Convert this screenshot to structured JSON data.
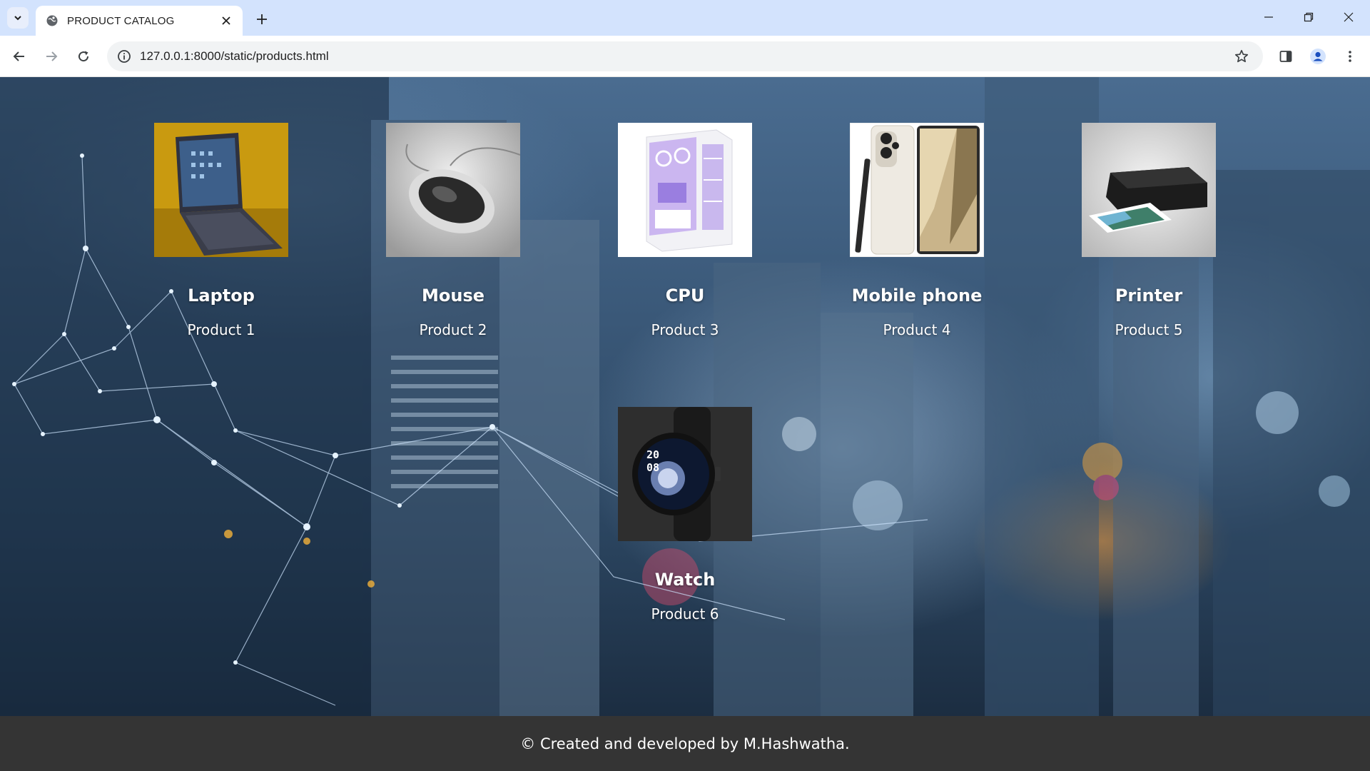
{
  "browser": {
    "tab_title": "PRODUCT CATALOG",
    "url": "127.0.0.1:8000/static/products.html",
    "icons": {
      "tab_search": "chevron-down-icon",
      "close_tab": "close-icon",
      "new_tab": "plus-icon",
      "back": "arrow-left-icon",
      "forward": "arrow-right-icon",
      "reload": "reload-icon",
      "site_info": "info-icon",
      "bookmark": "star-icon",
      "side_panel": "side-panel-icon",
      "profile": "profile-icon",
      "menu": "kebab-menu-icon"
    }
  },
  "products": [
    {
      "name": "Laptop",
      "label": "Product 1",
      "image_icon": "laptop-image"
    },
    {
      "name": "Mouse",
      "label": "Product 2",
      "image_icon": "mouse-image"
    },
    {
      "name": "CPU",
      "label": "Product 3",
      "image_icon": "cpu-case-image"
    },
    {
      "name": "Mobile phone",
      "label": "Product 4",
      "image_icon": "mobile-phone-image"
    },
    {
      "name": "Printer",
      "label": "Product 5",
      "image_icon": "printer-image"
    },
    {
      "name": "Watch",
      "label": "Product 6",
      "image_icon": "watch-image"
    }
  ],
  "footer": {
    "text": "© Created and developed by M.Hashwatha."
  },
  "colors": {
    "tabbar_bg": "#d3e3fd",
    "footer_bg": "#343434",
    "text_light": "#ffffff"
  }
}
